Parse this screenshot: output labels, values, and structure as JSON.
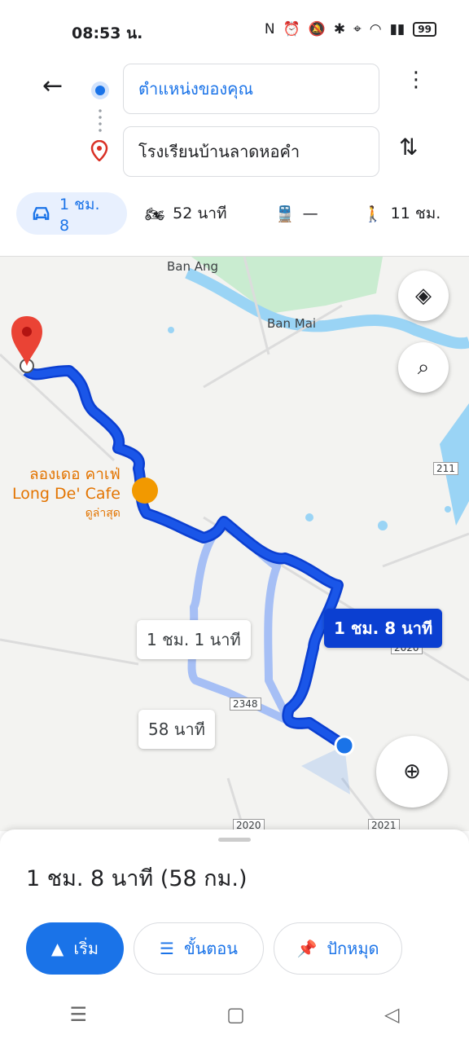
{
  "status_bar": {
    "time": "08:53 น.",
    "battery": "99"
  },
  "route": {
    "origin": "ตำแหน่งของคุณ",
    "destination": "โรงเรียนบ้านลาดหอคำ"
  },
  "modes": [
    {
      "icon": "car-icon",
      "label": "1 ชม. 8",
      "selected": true
    },
    {
      "icon": "motorcycle-icon",
      "label": "52 นาที"
    },
    {
      "icon": "train-icon",
      "label": "—"
    },
    {
      "icon": "walk-icon",
      "label": "11 ชม."
    }
  ],
  "map": {
    "places": [
      "Ban Ang",
      "Ban Mai"
    ],
    "poi": {
      "name_th": "ลองเดอ คาเฟ่",
      "name_en": "Long De' Cafe",
      "note": "ดูล่าสุด"
    },
    "road_numbers": [
      "211",
      "2020",
      "2348",
      "2020",
      "2021"
    ],
    "route_labels": {
      "main": "1 ชม. 8 นาที",
      "alt1": "1 ชม. 1 นาที",
      "alt2": "58 นาที"
    },
    "colors": {
      "route": "#1a56e8",
      "alt_route": "#a6bff5",
      "water": "#9ad4f5",
      "park": "#c9ecd0"
    }
  },
  "sheet": {
    "summary": "1 ชม. 8 นาที (58 กม.)",
    "start_label": "เริ่ม",
    "steps_label": "ขั้นตอน",
    "pin_label": "ปักหมุด"
  }
}
